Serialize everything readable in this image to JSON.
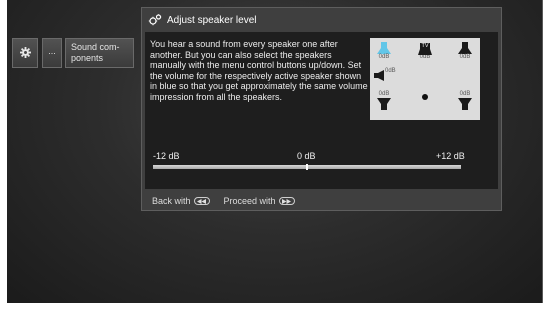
{
  "menu": {
    "items": [
      {
        "icon": "gear-icon"
      },
      {
        "label": "..."
      },
      {
        "label": "Sound com-\nponents"
      }
    ]
  },
  "dialog": {
    "title": "Adjust speaker level",
    "title_icon": "gear-pair-icon",
    "description": "You hear a sound from every speaker one after another. But you can also select the speakers manually with the menu control buttons up/down. Set the volume for the respectively active speaker shown in blue so that you get approximately the same volume impression from all the speakers.",
    "speakers": {
      "front_left": {
        "level": "0dB",
        "active": true
      },
      "center": {
        "label": "TV",
        "level": "0dB"
      },
      "front_right": {
        "level": "0dB"
      },
      "subwoofer": {
        "level": "0dB"
      },
      "rear_left": {
        "level": "0dB"
      },
      "rear_right": {
        "level": "0dB"
      }
    },
    "slider": {
      "min_label": "-12 dB",
      "mid_label": "0 dB",
      "max_label": "+12 dB",
      "value_fraction": 0.5
    },
    "footer": {
      "back_label": "Back with",
      "back_icon": "rewind-button-icon",
      "proceed_label": "Proceed with",
      "proceed_icon": "fast-forward-button-icon"
    }
  },
  "colors": {
    "active_speaker": "#62c6e8",
    "panel_bg": "#dcdcdc",
    "dialog_body": "#1e1e1e"
  }
}
